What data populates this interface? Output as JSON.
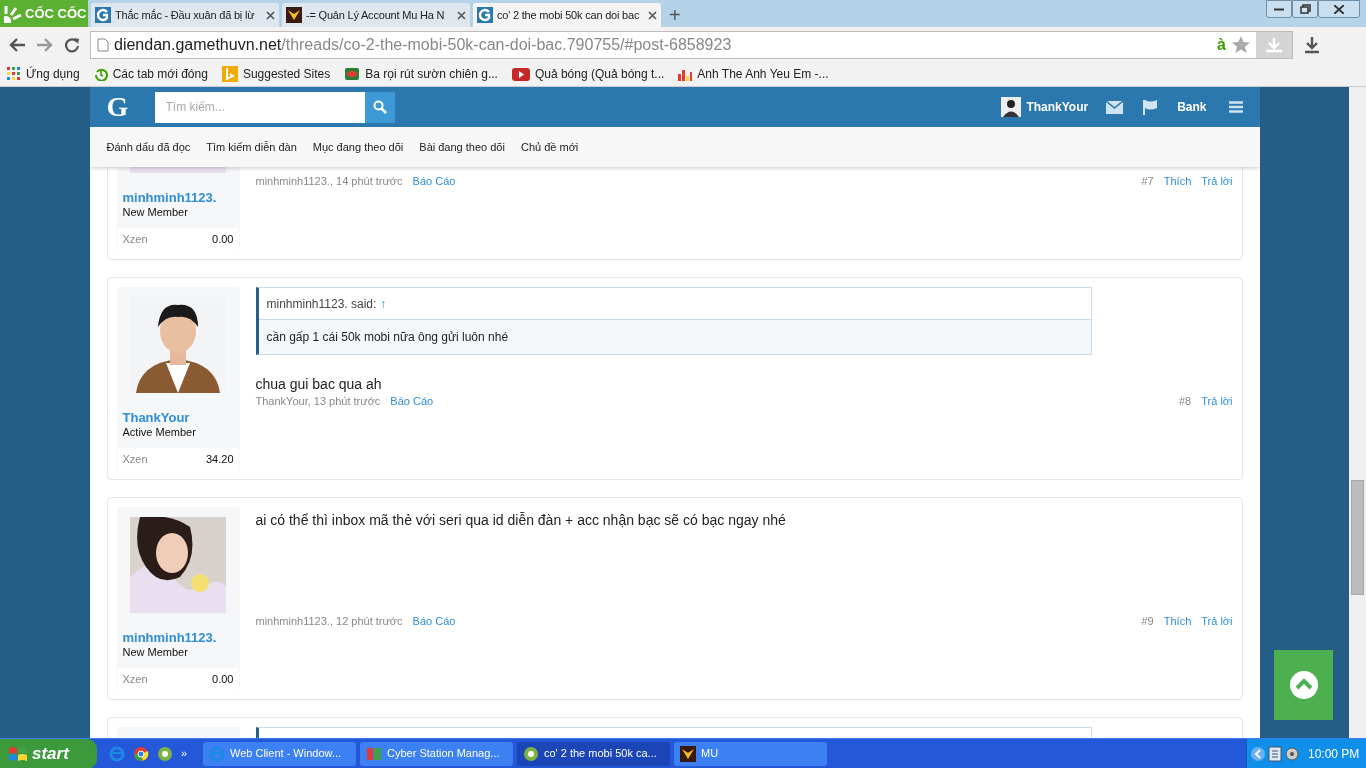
{
  "browser": {
    "logo": "CỐC CỐC",
    "tabs": [
      {
        "title": "Thắc mắc - Đầu xuân đã bị lừ",
        "selected": false
      },
      {
        "title": "-= Quản Lý Account Mu Ha N",
        "selected": false
      },
      {
        "title": "co' 2 the mobi 50k can doi bac",
        "selected": true
      }
    ],
    "new_tab": "+",
    "address": {
      "domain": "diendan.gamethuvn.net",
      "path": "/threads/co-2-the-mobi-50k-can-doi-bac.790755/#post-6858923"
    },
    "address_badge": "à",
    "bookmarks": [
      {
        "label": "Ứng dụng"
      },
      {
        "label": "Các tab mới đóng"
      },
      {
        "label": "Suggested Sites"
      },
      {
        "label": "Ba rọi rút sườn chiên g..."
      },
      {
        "label": "Quả bóng (Quả bóng t..."
      },
      {
        "label": "Anh The Anh Yeu Em -..."
      }
    ]
  },
  "site_header": {
    "logo": "G",
    "search": {
      "placeholder": "Tìm kiếm..."
    },
    "user": "ThankYour",
    "bank": "Bank"
  },
  "nav": [
    "Đánh dấu đã đọc",
    "Tìm kiếm diễn đàn",
    "Mục đang theo dõi",
    "Bài đang theo dõi",
    "Chủ đề mới"
  ],
  "posts": [
    {
      "user": "minhminh1123.",
      "role": "New Member",
      "stat_label": "Xzen",
      "stat_value": "0.00",
      "meta": "minhminh1123., 14 phút trước",
      "report": "Báo Cáo",
      "number": "#7",
      "like": "Thích",
      "reply": "Trả lời"
    },
    {
      "user": "ThankYour",
      "role": "Active Member",
      "stat_label": "Xzen",
      "stat_value": "34.20",
      "quote": {
        "author": "minhminh1123. said:",
        "arrow": "↑",
        "text": "cần gấp 1 cái 50k mobi nữa ông gửi luôn nhé"
      },
      "message": "chua gui bac qua ah",
      "meta": "ThankYour, 13 phút trước",
      "report": "Báo Cáo",
      "number": "#8",
      "reply": "Trả lời"
    },
    {
      "user": "minhminh1123.",
      "role": "New Member",
      "stat_label": "Xzen",
      "stat_value": "0.00",
      "message": "ai có thể thì inbox mã thẻ với seri qua id diễn đàn + acc nhận bạc sẽ có bạc ngay nhé",
      "meta": "minhminh1123., 12 phút trước",
      "report": "Báo Cáo",
      "number": "#9",
      "like": "Thích",
      "reply": "Trả lời"
    }
  ],
  "taskbar": {
    "start": "start",
    "overflow": "»",
    "tasks": [
      {
        "label": "Web Client - Window...",
        "selected": false
      },
      {
        "label": "Cyber Station Manag...",
        "selected": false
      },
      {
        "label": "co' 2 the mobi 50k ca...",
        "selected": true
      },
      {
        "label": "MU",
        "selected": false
      }
    ],
    "clock": "10:00 PM"
  }
}
